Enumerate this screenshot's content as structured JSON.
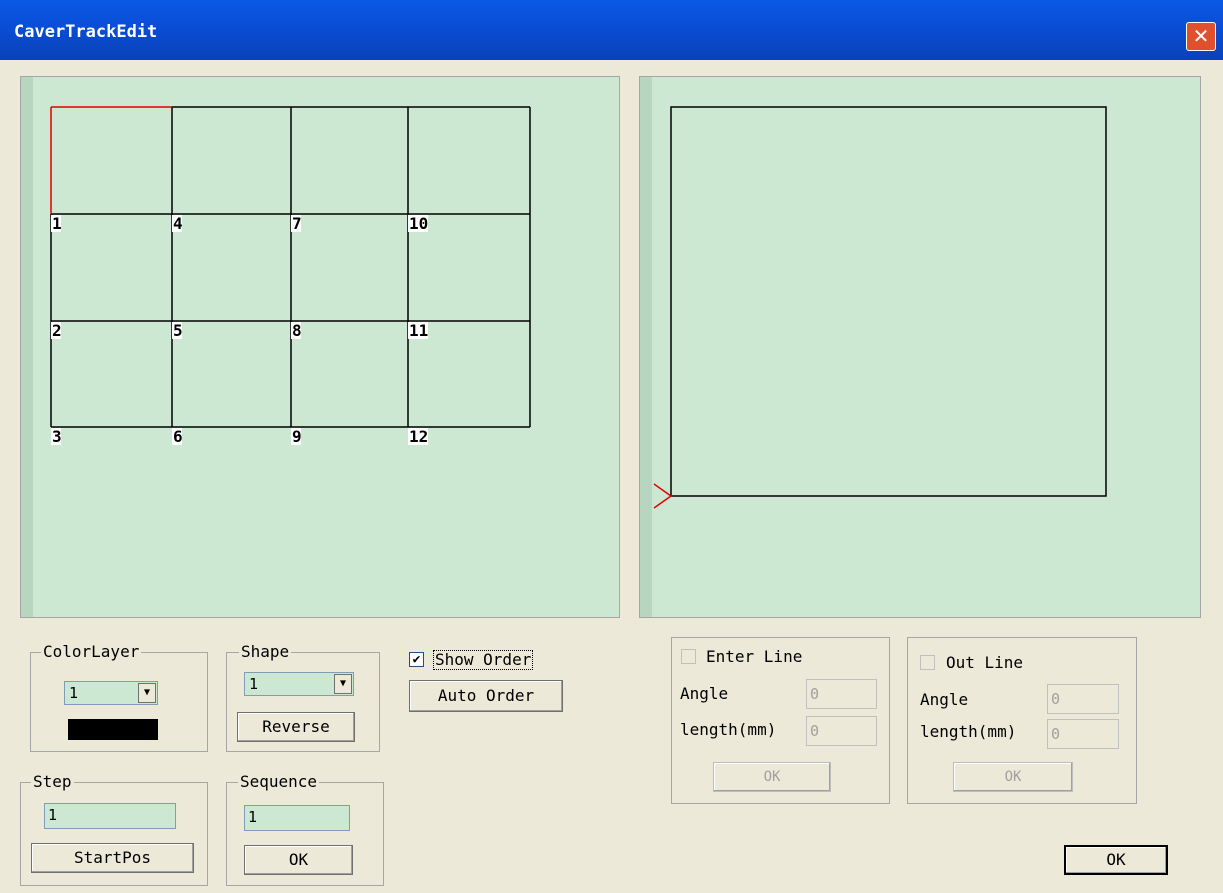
{
  "window": {
    "title": "CaverTrackEdit",
    "close_icon": "close-icon"
  },
  "order_labels": [
    "1",
    "2",
    "3",
    "4",
    "5",
    "6",
    "7",
    "8",
    "9",
    "10",
    "11",
    "12"
  ],
  "color_layer": {
    "label": "ColorLayer",
    "value": "1",
    "swatch_color": "#000000"
  },
  "shape": {
    "label": "Shape",
    "value": "1",
    "reverse_label": "Reverse"
  },
  "show_order": {
    "label": "Show Order",
    "checked": true,
    "auto_order_label": "Auto Order"
  },
  "step": {
    "label": "Step",
    "value": "1",
    "start_pos_label": "StartPos"
  },
  "sequence": {
    "label": "Sequence",
    "value": "1",
    "ok_label": "OK"
  },
  "enter_line": {
    "label": "Enter Line",
    "angle_label": "Angle",
    "angle_value": "0",
    "length_label": "length(mm)",
    "length_value": "0",
    "ok_label": "OK"
  },
  "out_line": {
    "label": "Out Line",
    "angle_label": "Angle",
    "angle_value": "0",
    "length_label": "length(mm)",
    "length_value": "0",
    "ok_label": "OK"
  },
  "main_ok_label": "OK",
  "colors": {
    "canvas_bg": "#cce7d2",
    "highlight": "#e00000",
    "title_bar": "#0a50dc"
  }
}
